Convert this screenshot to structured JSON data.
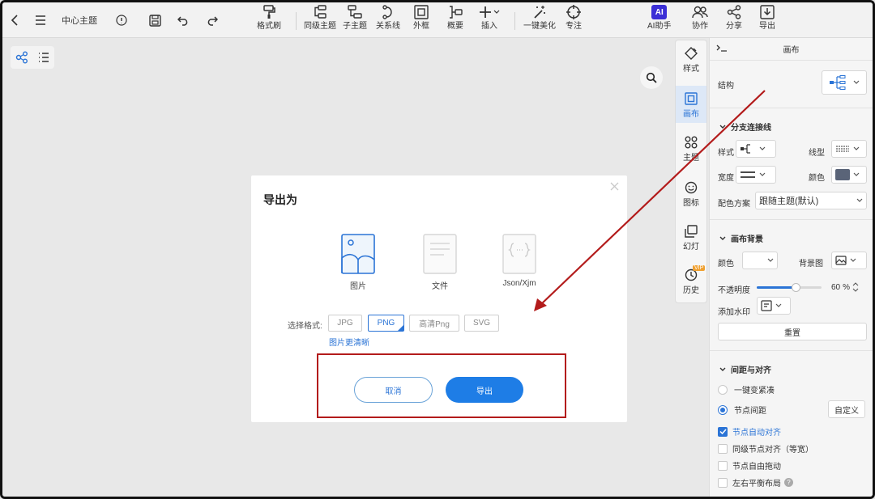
{
  "app": {
    "title": "中心主题"
  },
  "toolbar": {
    "format_painter": "格式刷",
    "sibling_topic": "同级主题",
    "child_topic": "子主题",
    "relationship": "关系线",
    "boundary": "外框",
    "summary": "概要",
    "insert": "插入",
    "beautify": "一键美化",
    "focus": "专注",
    "ai_assistant": "AI助手",
    "ai_badge": "AI",
    "collaborate": "协作",
    "share": "分享",
    "export": "导出"
  },
  "side_tabs": {
    "style": "样式",
    "canvas": "画布",
    "theme": "主题",
    "icon": "图标",
    "slides": "幻灯",
    "history": "历史",
    "vip": "VIP"
  },
  "panel": {
    "title": "画布",
    "structure_label": "结构",
    "branch_section": "分支连接线",
    "style_label": "样式",
    "line_type_label": "线型",
    "width_label": "宽度",
    "color_label": "颜色",
    "color_scheme_label": "配色方案",
    "color_scheme_value": "跟随主题(默认)",
    "bg_section": "画布背景",
    "bg_color_label": "颜色",
    "bg_image_label": "背景图",
    "opacity_label": "不透明度",
    "opacity_value": "60",
    "opacity_unit": "%",
    "opacity_fraction": 0.6,
    "watermark_label": "添加水印",
    "reset_label": "重置",
    "spacing_section": "间距与对齐",
    "compact_label": "一键变紧凑",
    "node_spacing_label": "节点间距",
    "custom_label": "自定义",
    "auto_align_label": "节点自动对齐",
    "same_level_align_label": "同级节点对齐（等宽）",
    "free_drag_label": "节点自由拖动",
    "balanced_layout_label": "左右平衡布局",
    "branch_color": "#5a6478"
  },
  "dialog": {
    "title": "导出为",
    "types": [
      {
        "label": "图片"
      },
      {
        "label": "文件"
      },
      {
        "label": "Json/Xjm"
      }
    ],
    "format_label": "选择格式:",
    "formats": [
      "JPG",
      "PNG",
      "高清Png",
      "SVG"
    ],
    "selected_format": "PNG",
    "hint": "图片更清晰",
    "cancel": "取消",
    "confirm": "导出"
  },
  "colors": {
    "accent": "#2b74d6",
    "annotation": "#b31b1b"
  }
}
